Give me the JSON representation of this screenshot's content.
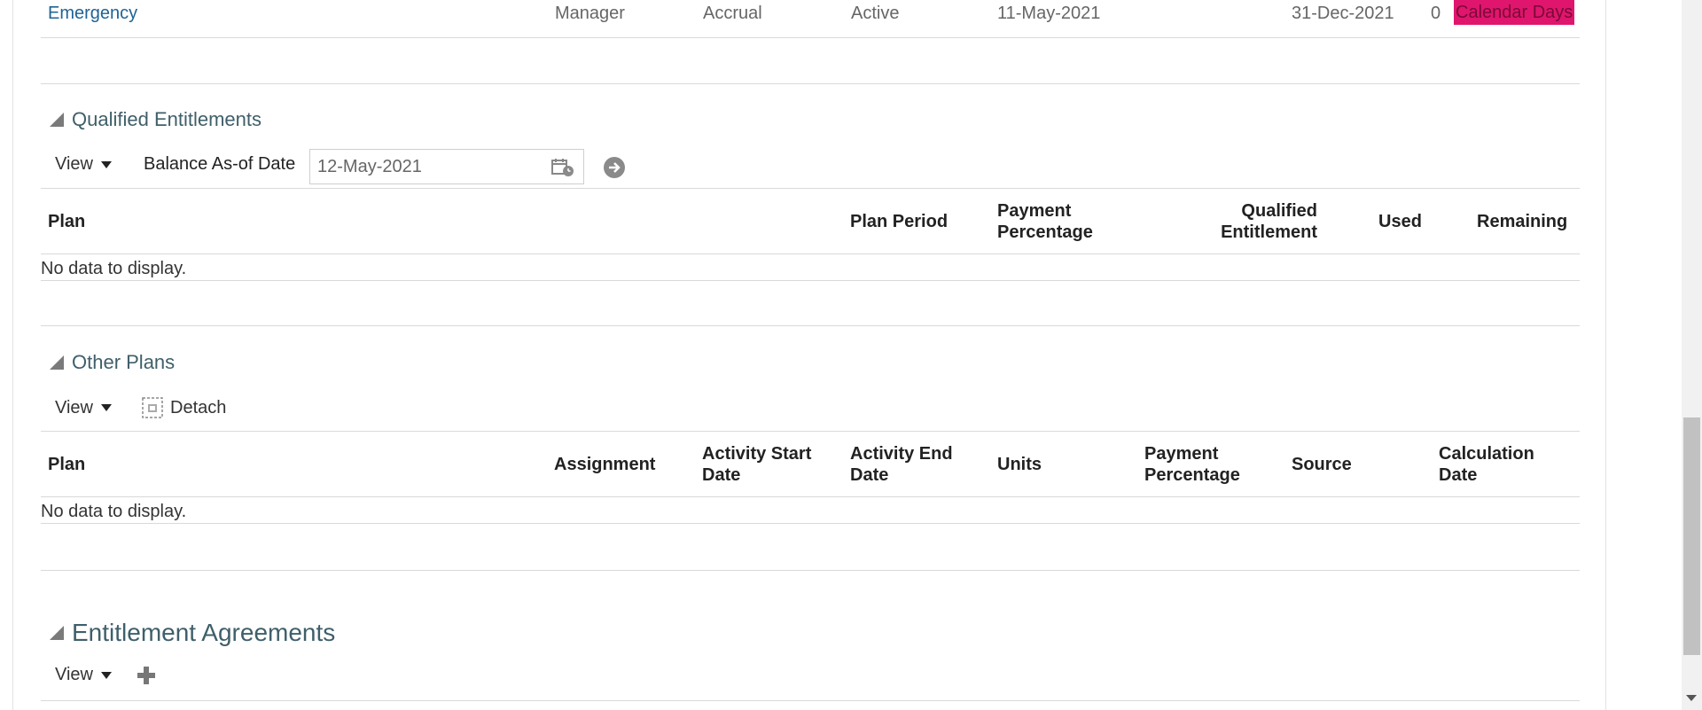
{
  "top_row": {
    "plan": "Emergency",
    "assignment": "Manager",
    "plan_type": "Accrual",
    "status": "Active",
    "start_date": "11-May-2021",
    "end_date": "31-Dec-2021",
    "balance": "0",
    "unit": "Calendar Days"
  },
  "qualified": {
    "title": "Qualified Entitlements",
    "view_label": "View",
    "balance_label": "Balance As-of Date",
    "balance_date": "12-May-2021",
    "headers": {
      "plan": "Plan",
      "plan_period": "Plan Period",
      "payment_percentage_1": "Payment",
      "payment_percentage_2": "Percentage",
      "qualified_entitlement_1": "Qualified",
      "qualified_entitlement_2": "Entitlement",
      "used": "Used",
      "remaining": "Remaining"
    },
    "empty_text": "No data to display."
  },
  "other": {
    "title": "Other Plans",
    "view_label": "View",
    "detach_label": "Detach",
    "headers": {
      "plan": "Plan",
      "assignment": "Assignment",
      "activity_start_1": "Activity Start",
      "activity_start_2": "Date",
      "activity_end_1": "Activity End",
      "activity_end_2": "Date",
      "units": "Units",
      "payment_percentage_1": "Payment",
      "payment_percentage_2": "Percentage",
      "source": "Source",
      "calculation_date_1": "Calculation",
      "calculation_date_2": "Date"
    },
    "empty_text": "No data to display."
  },
  "entitlement": {
    "title": "Entitlement Agreements",
    "view_label": "View"
  },
  "icons": {
    "calendar": "calendar-icon",
    "go": "go-arrow-icon",
    "detach": "detach-icon",
    "add": "add-icon",
    "collapse": "collapse-triangle-icon"
  },
  "colors": {
    "link": "#1f6394",
    "section_title": "#3f5f6a",
    "highlight": "#e0156e"
  }
}
